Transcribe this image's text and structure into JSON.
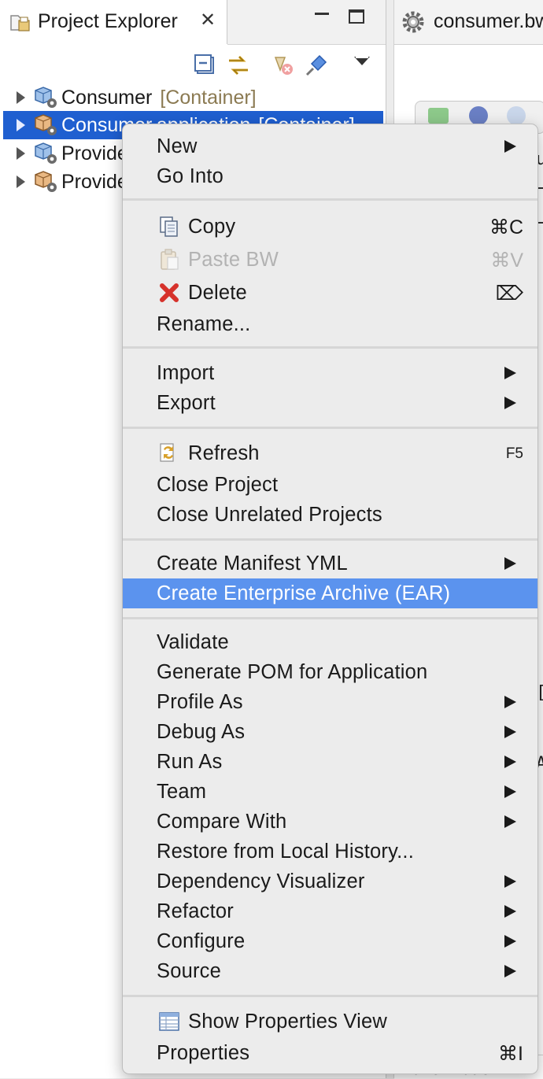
{
  "explorer": {
    "title": "Project Explorer",
    "projects": [
      {
        "name": "Consumer",
        "tag": "[Container]",
        "selected": false
      },
      {
        "name": "Consumer.application",
        "tag": "[Container]",
        "selected": true
      },
      {
        "name": "Provider",
        "tag": "",
        "selected": false
      },
      {
        "name": "Provider",
        "tag": "",
        "selected": false
      }
    ]
  },
  "editor": {
    "tab_title": "consumer.bwp",
    "fragments": [
      "ur",
      "[",
      "A"
    ],
    "bottom_text": "<bwextbdeA"
  },
  "context_menu": {
    "items": [
      {
        "label": "New",
        "submenu": true
      },
      {
        "label": "Go Into"
      },
      {
        "label": "Copy",
        "shortcut": "⌘C",
        "icon": "copy-icon"
      },
      {
        "label": "Paste BW",
        "shortcut": "⌘V",
        "icon": "paste-icon",
        "disabled": true
      },
      {
        "label": "Delete",
        "shortcut": "⌦",
        "icon": "delete-icon"
      },
      {
        "label": "Rename..."
      },
      {
        "label": "Import",
        "submenu": true
      },
      {
        "label": "Export",
        "submenu": true
      },
      {
        "label": "Refresh",
        "shortcut": "F5",
        "icon": "refresh-icon"
      },
      {
        "label": "Close Project"
      },
      {
        "label": "Close Unrelated Projects"
      },
      {
        "label": "Create Manifest YML",
        "submenu": true
      },
      {
        "label": "Create Enterprise Archive (EAR)",
        "highlighted": true
      },
      {
        "label": "Validate"
      },
      {
        "label": "Generate POM for Application"
      },
      {
        "label": "Profile As",
        "submenu": true
      },
      {
        "label": "Debug As",
        "submenu": true
      },
      {
        "label": "Run As",
        "submenu": true
      },
      {
        "label": "Team",
        "submenu": true
      },
      {
        "label": "Compare With",
        "submenu": true
      },
      {
        "label": "Restore from Local History..."
      },
      {
        "label": "Dependency Visualizer",
        "submenu": true
      },
      {
        "label": "Refactor",
        "submenu": true
      },
      {
        "label": "Configure",
        "submenu": true
      },
      {
        "label": "Source",
        "submenu": true
      },
      {
        "label": "Show Properties View",
        "icon": "properties-view-icon"
      },
      {
        "label": "Properties",
        "shortcut": "⌘I"
      }
    ]
  },
  "colors": {
    "selection": "#1f5fd0",
    "menu_highlight": "#5b93ee",
    "menu_background": "#ececec",
    "tag_text": "#8b7a52"
  }
}
